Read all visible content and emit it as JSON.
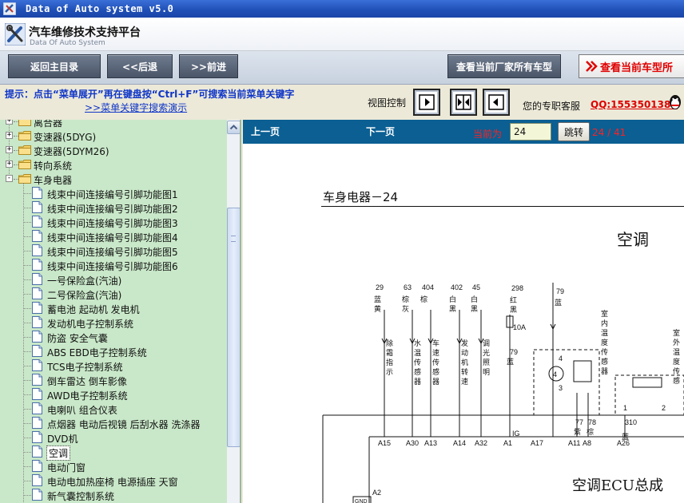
{
  "window": {
    "title": "Data of Auto system v5.0"
  },
  "brand": {
    "title": "汽车维修技术支持平台",
    "subtitle": "Data Of Auto System"
  },
  "nav": {
    "home": "返回主目录",
    "back": "<<后退",
    "forward": ">>前进",
    "all_models": "查看当前厂家所有车型",
    "current_model": "查看当前车型所"
  },
  "hint": {
    "line1": "提示：点击“菜单展开”再在键盘按“Ctrl+F”可搜索当前菜单关键字",
    "line2": ">>菜单关键字搜索演示",
    "view_label": "视图控制",
    "service_label": "您的专职客服",
    "qq": "QQ:1553501388"
  },
  "tree": {
    "folders": [
      {
        "label": "离合器",
        "expander": "+"
      },
      {
        "label": "变速器(5DYG)",
        "expander": "+"
      },
      {
        "label": "变速器(5DYM26)",
        "expander": "+"
      },
      {
        "label": "转向系统",
        "expander": "+"
      },
      {
        "label": "车身电器",
        "expander": "-"
      }
    ],
    "items": [
      "线束中间连接编号引脚功能图1",
      "线束中间连接编号引脚功能图2",
      "线束中间连接编号引脚功能图3",
      "线束中间连接编号引脚功能图4",
      "线束中间连接编号引脚功能图5",
      "线束中间连接编号引脚功能图6",
      "一号保险盒(汽油)",
      "二号保险盒(汽油)",
      "蓄电池 起动机 发电机",
      "发动机电子控制系统",
      "防盗 安全气囊",
      "ABS EBD电子控制系统",
      "TCS电子控制系统",
      "倒车雷达 倒车影像",
      "AWD电子控制系统",
      "电喇叭 组合仪表",
      "点烟器 电动后视镜 后刮水器 洗涤器",
      "DVD机",
      "空调",
      "电动门窗",
      "电动电加热座椅 电源插座 天窗",
      "新气囊控制系统"
    ],
    "selected_index": 18
  },
  "pager": {
    "prev": "上一页",
    "next": "下一页",
    "current_label": "当前为",
    "page_value": "24",
    "go": "跳转",
    "count": "24 / 41"
  },
  "diagram": {
    "heading": "车身电器－24",
    "title": "空调",
    "ecu_label": "空调ECU总成",
    "wires": [
      {
        "num": "29",
        "color": "蓝黄",
        "func": "除霜指示",
        "pin": "A15"
      },
      {
        "num": "63",
        "color": "棕灰",
        "func": "水温传感器",
        "pin": "A30"
      },
      {
        "num": "404",
        "color": "棕",
        "func": "车速传感器",
        "pin": "A13"
      },
      {
        "num": "402",
        "color": "白黑",
        "func": "发动机转速",
        "pin": "A14"
      },
      {
        "num": "45",
        "color": "白黑",
        "func": "调光照明",
        "pin": "A32"
      }
    ],
    "fuse_wire": {
      "num": "298",
      "color": "红黑",
      "fuse": "10A"
    },
    "wire_79_top": {
      "num": "79",
      "color": "蓝"
    },
    "wire_79_mid": {
      "num": "79",
      "color": "蓝"
    },
    "wire_77": {
      "num": "77",
      "color": "紫"
    },
    "wire_78": {
      "num": "78",
      "color": "棕"
    },
    "wire_310": {
      "num": "310",
      "color": "蓝"
    },
    "sensor_inner": "室内温度传感器",
    "sensor_outer": "室外温度传感",
    "motor_pins": [
      "4",
      "3"
    ],
    "sensor_pins": [
      "1",
      "2"
    ],
    "ig": "IG",
    "pins_bottom": [
      "A1",
      "A17",
      "A11",
      "A8",
      "A26",
      "A2"
    ],
    "gnd": "GND"
  }
}
